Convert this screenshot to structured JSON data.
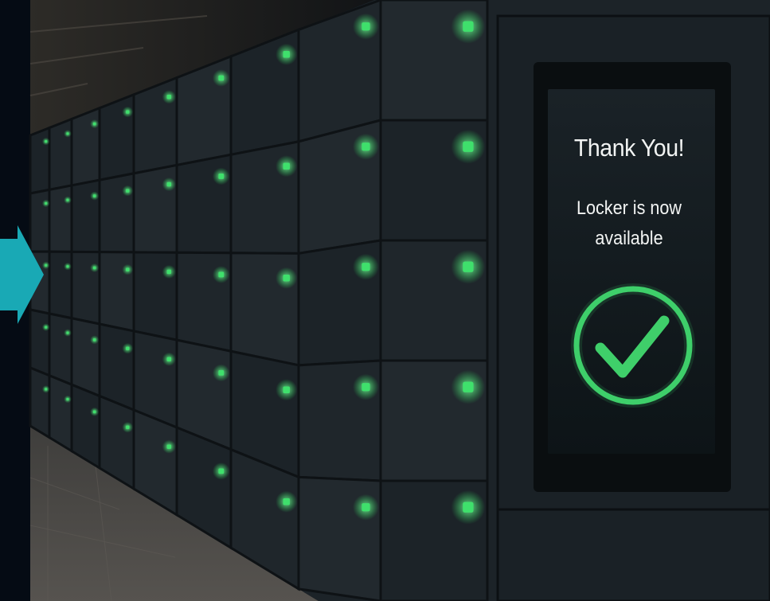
{
  "kiosk_screen": {
    "heading": "Thank You!",
    "message_line1": "Locker is now",
    "message_line2": "available",
    "status_icon": "check-circle-icon",
    "accent_color": "#3fcf6a"
  },
  "navigation": {
    "arrow_icon": "arrow-right-icon",
    "arrow_color": "#19a9b5"
  },
  "scene": {
    "indicator_color": "#3fe06c",
    "locker_color": "#1e262d"
  }
}
